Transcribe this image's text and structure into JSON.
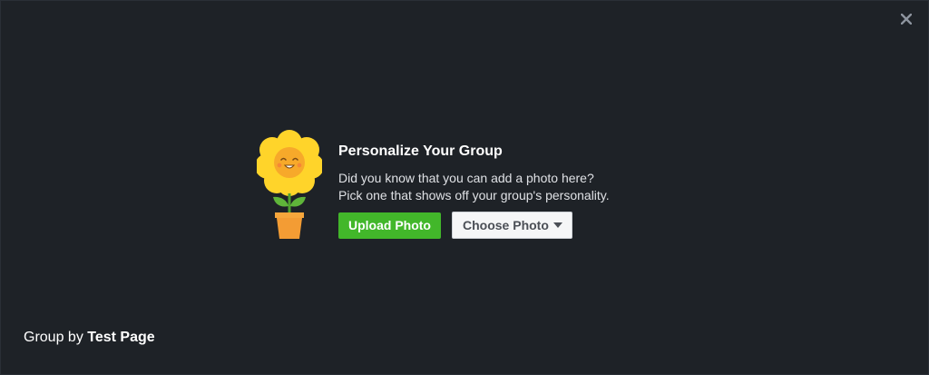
{
  "close_icon": "close-icon",
  "illustration_icon": "flower-pot-icon",
  "promo": {
    "title": "Personalize Your Group",
    "line1": "Did you know that you can add a photo here?",
    "line2": "Pick one that shows off your group's personality."
  },
  "buttons": {
    "upload_label": "Upload Photo",
    "choose_label": "Choose Photo",
    "choose_icon": "caret-down-icon"
  },
  "byline": {
    "prefix": "Group by",
    "page_name": "Test Page"
  },
  "colors": {
    "background": "#1e2227",
    "upload_button": "#42b72a",
    "choose_button": "#f5f6f7",
    "petal_yellow": "#ffd42a",
    "flower_center": "#f7a92a",
    "pot": "#f39c34",
    "leaf": "#5fb53a"
  }
}
